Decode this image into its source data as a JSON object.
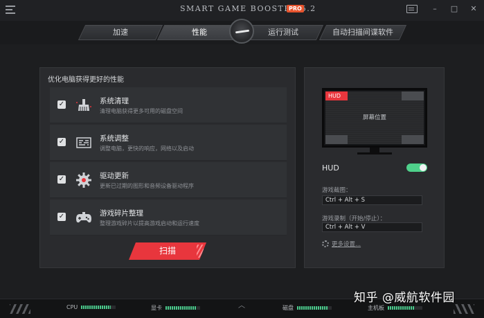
{
  "titlebar": {
    "title": "SMART GAME BOOSTER 5.2",
    "version_badge": "PRO",
    "min": "–",
    "max": "□",
    "close": "✕"
  },
  "tabs": [
    {
      "label": "加速",
      "active": false
    },
    {
      "label": "性能",
      "active": true
    },
    {
      "label": "运行测试",
      "active": false
    },
    {
      "label": "自动扫描间谍软件",
      "active": false
    }
  ],
  "left_panel": {
    "title": "优化电脑获得更好的性能",
    "items": [
      {
        "title": "系统清理",
        "desc": "清理电脑获得更多可用的磁盘空间",
        "checked": "✓",
        "icon": "broom-icon"
      },
      {
        "title": "系统调整",
        "desc": "调整电脑，更快的响应，网络以及启动",
        "checked": "✓",
        "icon": "sliders-icon"
      },
      {
        "title": "驱动更新",
        "desc": "更新已过期的图形和音频设备驱动程序",
        "checked": "✓",
        "icon": "gear-icon"
      },
      {
        "title": "游戏碎片整理",
        "desc": "整理游戏碎片以提高游戏启动和运行速度",
        "checked": "✓",
        "icon": "gamepad-icon"
      }
    ],
    "scan_label": "扫描"
  },
  "right_panel": {
    "hud_tag": "HUD",
    "screen_position": "屏幕位置",
    "hud_label": "HUD",
    "hud_enabled": true,
    "screenshot_label": "游戏截图：",
    "screenshot_hotkey": "Ctrl + Alt + S",
    "record_label": "游戏录制（开始/停止）：",
    "record_hotkey": "Ctrl + Alt + V",
    "more_settings": "更多设置..."
  },
  "bottombar": {
    "meters": [
      {
        "label": "CPU",
        "level": 0.85
      },
      {
        "label": "显卡",
        "level": 0.9
      },
      {
        "label": "磁盘",
        "level": 0.88
      },
      {
        "label": "主机板",
        "level": 0.75
      }
    ]
  },
  "watermark": "知乎 @威航软件园",
  "colors": {
    "accent_red": "#e8363d",
    "toggle_green": "#4fd18b",
    "meter_green": "#49c98a",
    "badge_orange": "#e8542e"
  }
}
